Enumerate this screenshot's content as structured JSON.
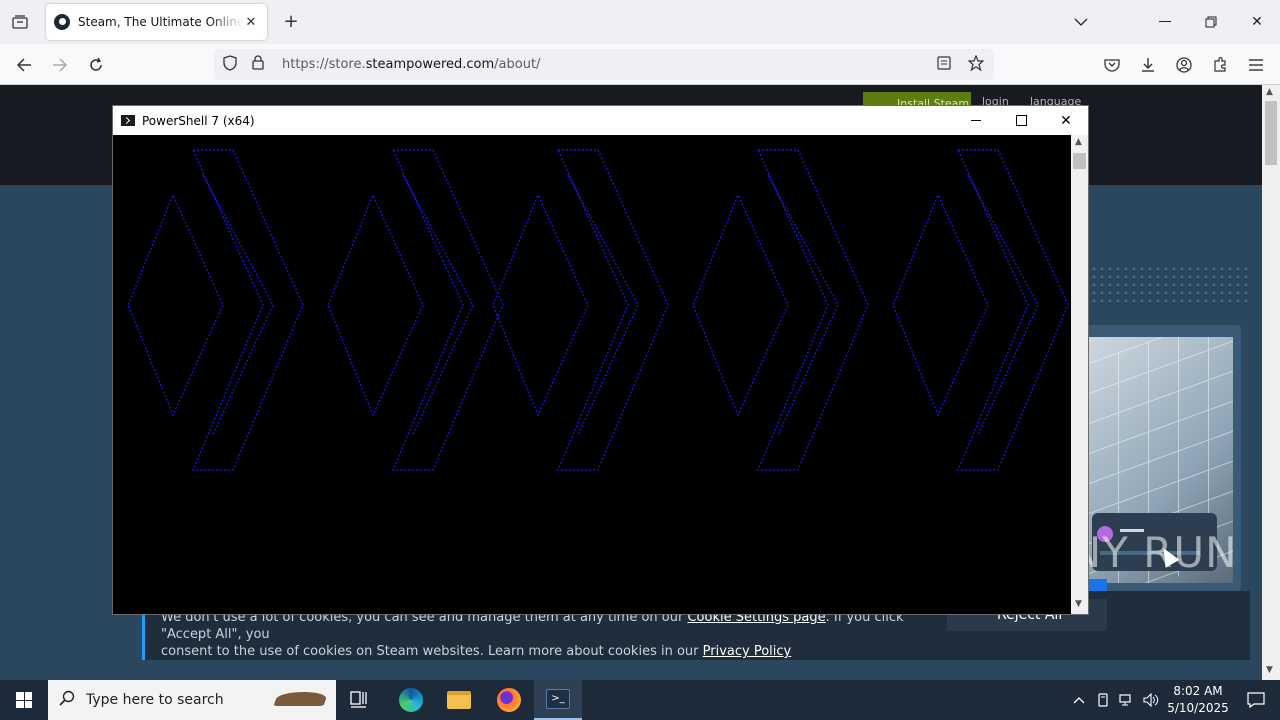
{
  "browser": {
    "tab_title": "Steam, The Ultimate Online Game Platform",
    "url_prefix": "https://store.",
    "url_domain": "steampowered.com",
    "url_path": "/about/"
  },
  "steam_page": {
    "install_label": "Install Steam",
    "login_label": "login",
    "language_label": "language",
    "cookie_line1_a": "We don't use a lot of cookies, you can see and manage them at any time on our ",
    "cookie_link_settings": "Cookie Settings page",
    "cookie_line1_b": ". If you click \"Accept All\", you",
    "cookie_line2_a": "consent to the use of cookies on Steam websites. Learn more about cookies in our ",
    "cookie_link_privacy": "Privacy Policy",
    "reject_label": "Reject All"
  },
  "watermark": "ANY RUN",
  "powershell": {
    "title": "PowerShell 7 (x64)",
    "ascii_color": "#1a1aff"
  },
  "taskbar": {
    "search_placeholder": "Type here to search",
    "time": "8:02 AM",
    "date": "5/10/2025"
  },
  "colors": {
    "steam_bg": "#1b2838",
    "taskbar_bg": "#1c2a3a"
  }
}
